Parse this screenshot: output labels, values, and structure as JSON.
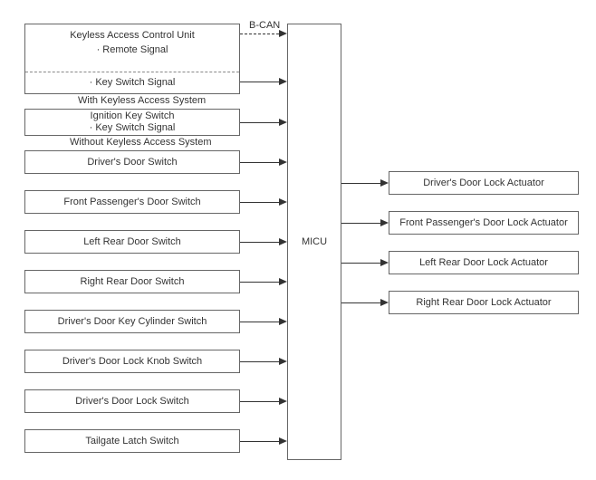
{
  "central": {
    "label": "MICU"
  },
  "bcan_label": "B-CAN",
  "kacu": {
    "title": "Keyless Access Control Unit",
    "line1": "· Remote Signal",
    "line2": "· Key Switch Signal",
    "caption": "With Keyless Access System"
  },
  "ignition": {
    "line1": "Ignition Key Switch",
    "line2": "· Key Switch Signal",
    "caption": "Without Keyless Access System"
  },
  "inputs": {
    "b0": "Driver's Door Switch",
    "b1": "Front Passenger's Door Switch",
    "b2": "Left Rear Door Switch",
    "b3": "Right Rear Door Switch",
    "b4": "Driver's Door Key Cylinder Switch",
    "b5": "Driver's Door Lock Knob Switch",
    "b6": "Driver's Door Lock Switch",
    "b7": "Tailgate Latch Switch"
  },
  "outputs": {
    "o0": "Driver's Door Lock Actuator",
    "o1": "Front Passenger's Door Lock Actuator",
    "o2": "Left Rear Door Lock Actuator",
    "o3": "Right Rear Door Lock Actuator"
  }
}
